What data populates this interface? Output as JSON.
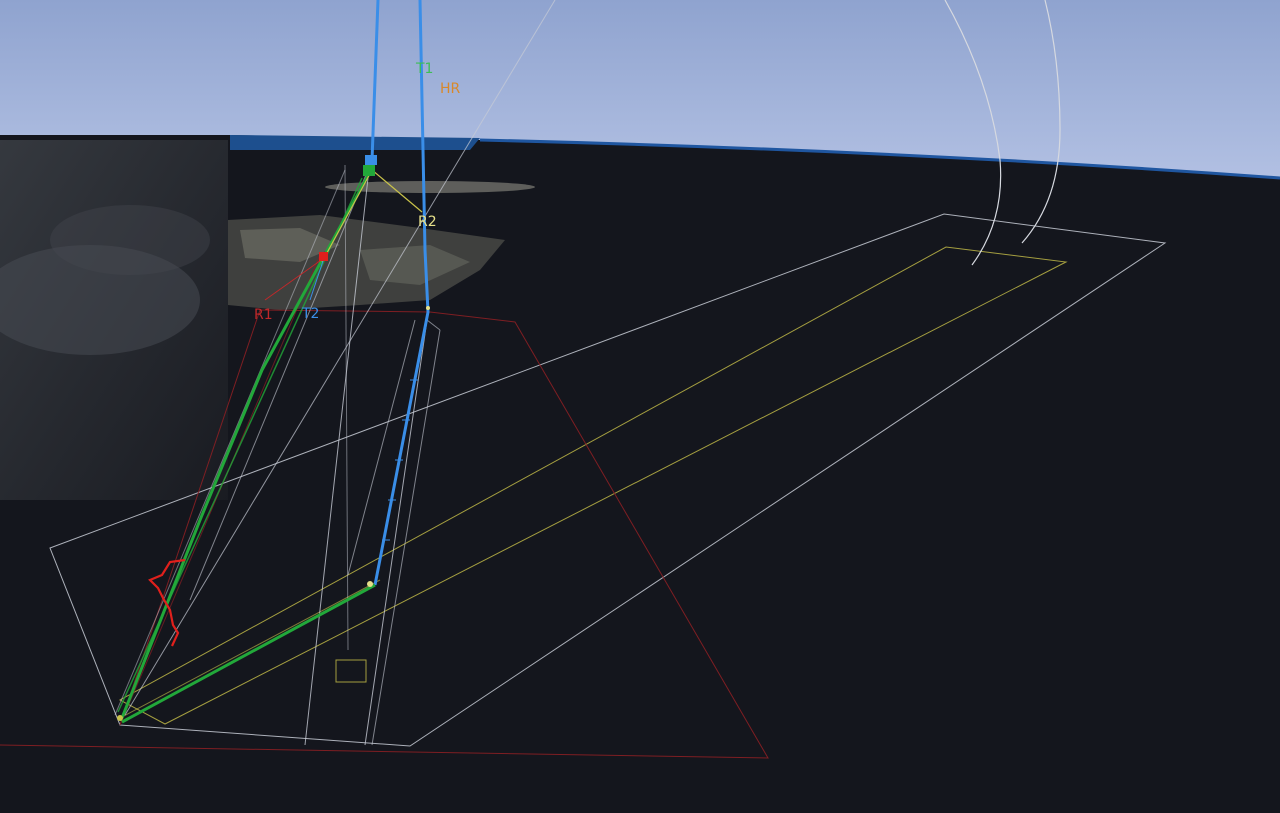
{
  "labels": {
    "t1": "T1",
    "hr": "HR",
    "r2": "R2",
    "t2": "T2",
    "r1": "R1"
  },
  "colors": {
    "sky": "#9fb0d6",
    "ground": "#14161d",
    "path_blue": "#3a8ee8",
    "path_green": "#22a83a",
    "boundary_white": "#c8ccd6",
    "boundary_yellow": "#c9c24a",
    "boundary_red": "#8a1f24",
    "marker_red": "#e0201c",
    "label_green": "#3cbf56",
    "label_orange": "#d8882a",
    "label_yellow": "#e6e08a",
    "label_blue": "#3a8ee8",
    "label_red": "#c0282a"
  }
}
